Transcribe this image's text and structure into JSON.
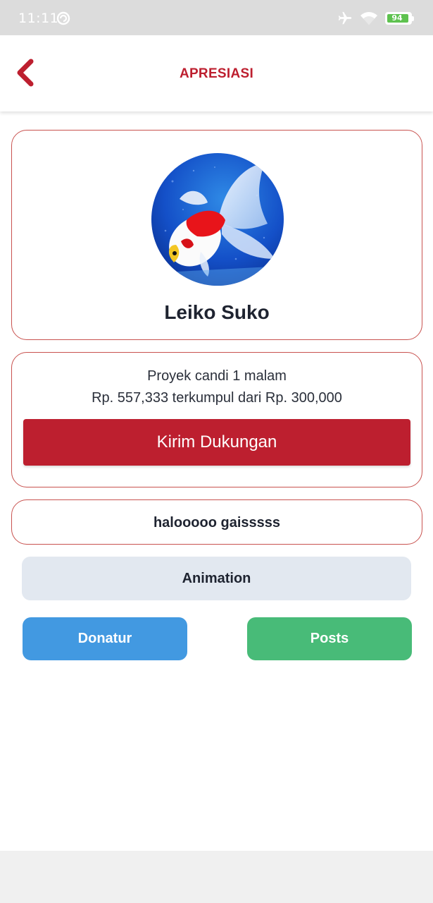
{
  "status_bar": {
    "time": "11:11",
    "battery_level": "94",
    "icons": [
      "sync-icon",
      "airplane-icon",
      "wifi-icon",
      "battery-icon"
    ]
  },
  "header": {
    "title": "APRESIASI",
    "back_icon": "chevron-left-icon"
  },
  "profile": {
    "name": "Leiko Suko",
    "avatar": "goldfish-photo"
  },
  "project": {
    "name": "Proyek candi 1 malam",
    "progress_text": "Rp. 557,333 terkumpul dari Rp. 300,000",
    "support_label": "Kirim Dukungan"
  },
  "message": {
    "text": "halooooo gaisssss"
  },
  "buttons": {
    "animation": "Animation",
    "donatur": "Donatur",
    "posts": "Posts"
  },
  "colors": {
    "accent": "#bd1f2f",
    "card_border": "#c8524f",
    "donatur": "#4299e1",
    "posts": "#48bb78",
    "animation": "#e2e8f0",
    "status_bar": "#dcdcdc"
  }
}
